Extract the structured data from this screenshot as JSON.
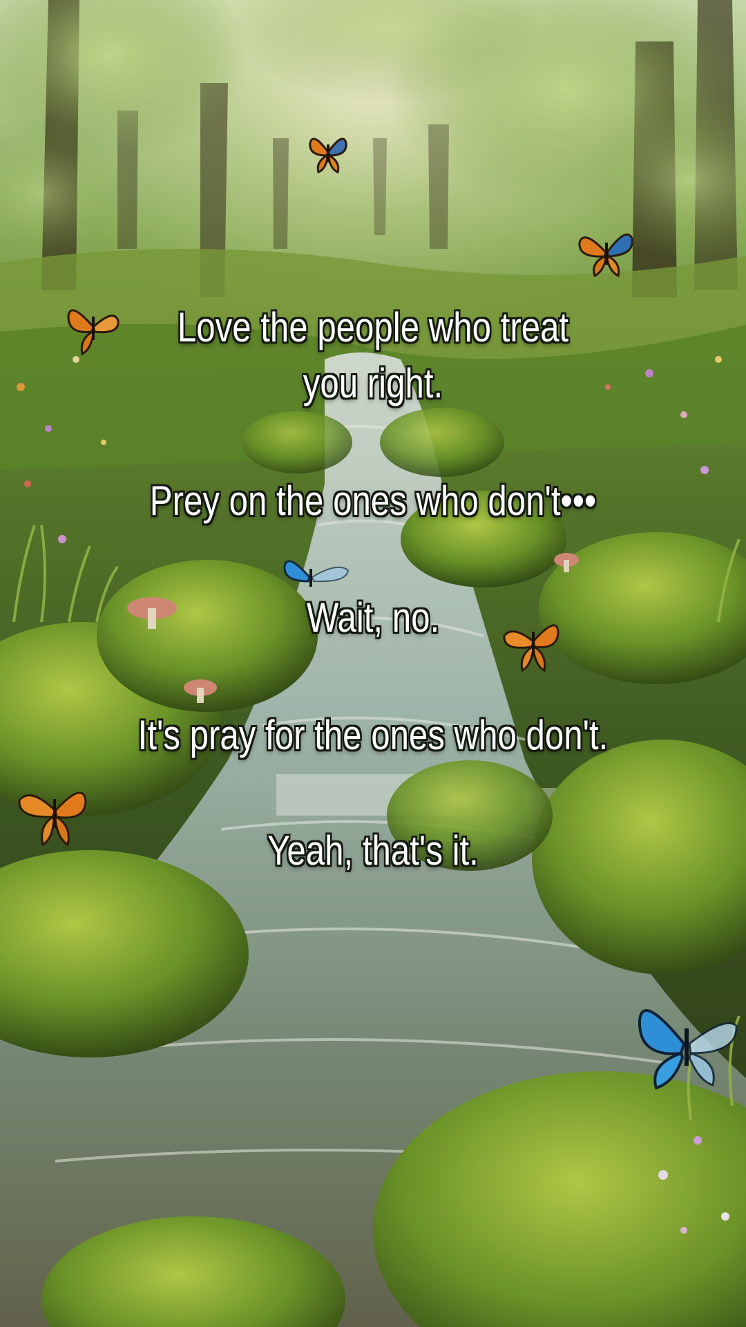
{
  "quote": {
    "line1": "Love the people who treat",
    "line2": "you right.",
    "line3": "Prey on the ones who don't•••",
    "line4": "Wait, no.",
    "line5": "It's pray for the ones who don't.",
    "line6": "Yeah, that's it."
  },
  "colors": {
    "text": "#ffffff",
    "text_outline": "#141a10",
    "stream_water": "#9bb7b0",
    "moss": "#6f9a2a",
    "foliage": "#a9c86a",
    "monarch_orange": "#e07a1c",
    "blue_morpho": "#2f8fd6"
  },
  "icons": [
    "monarch-butterfly-icon",
    "blue-butterfly-icon"
  ]
}
